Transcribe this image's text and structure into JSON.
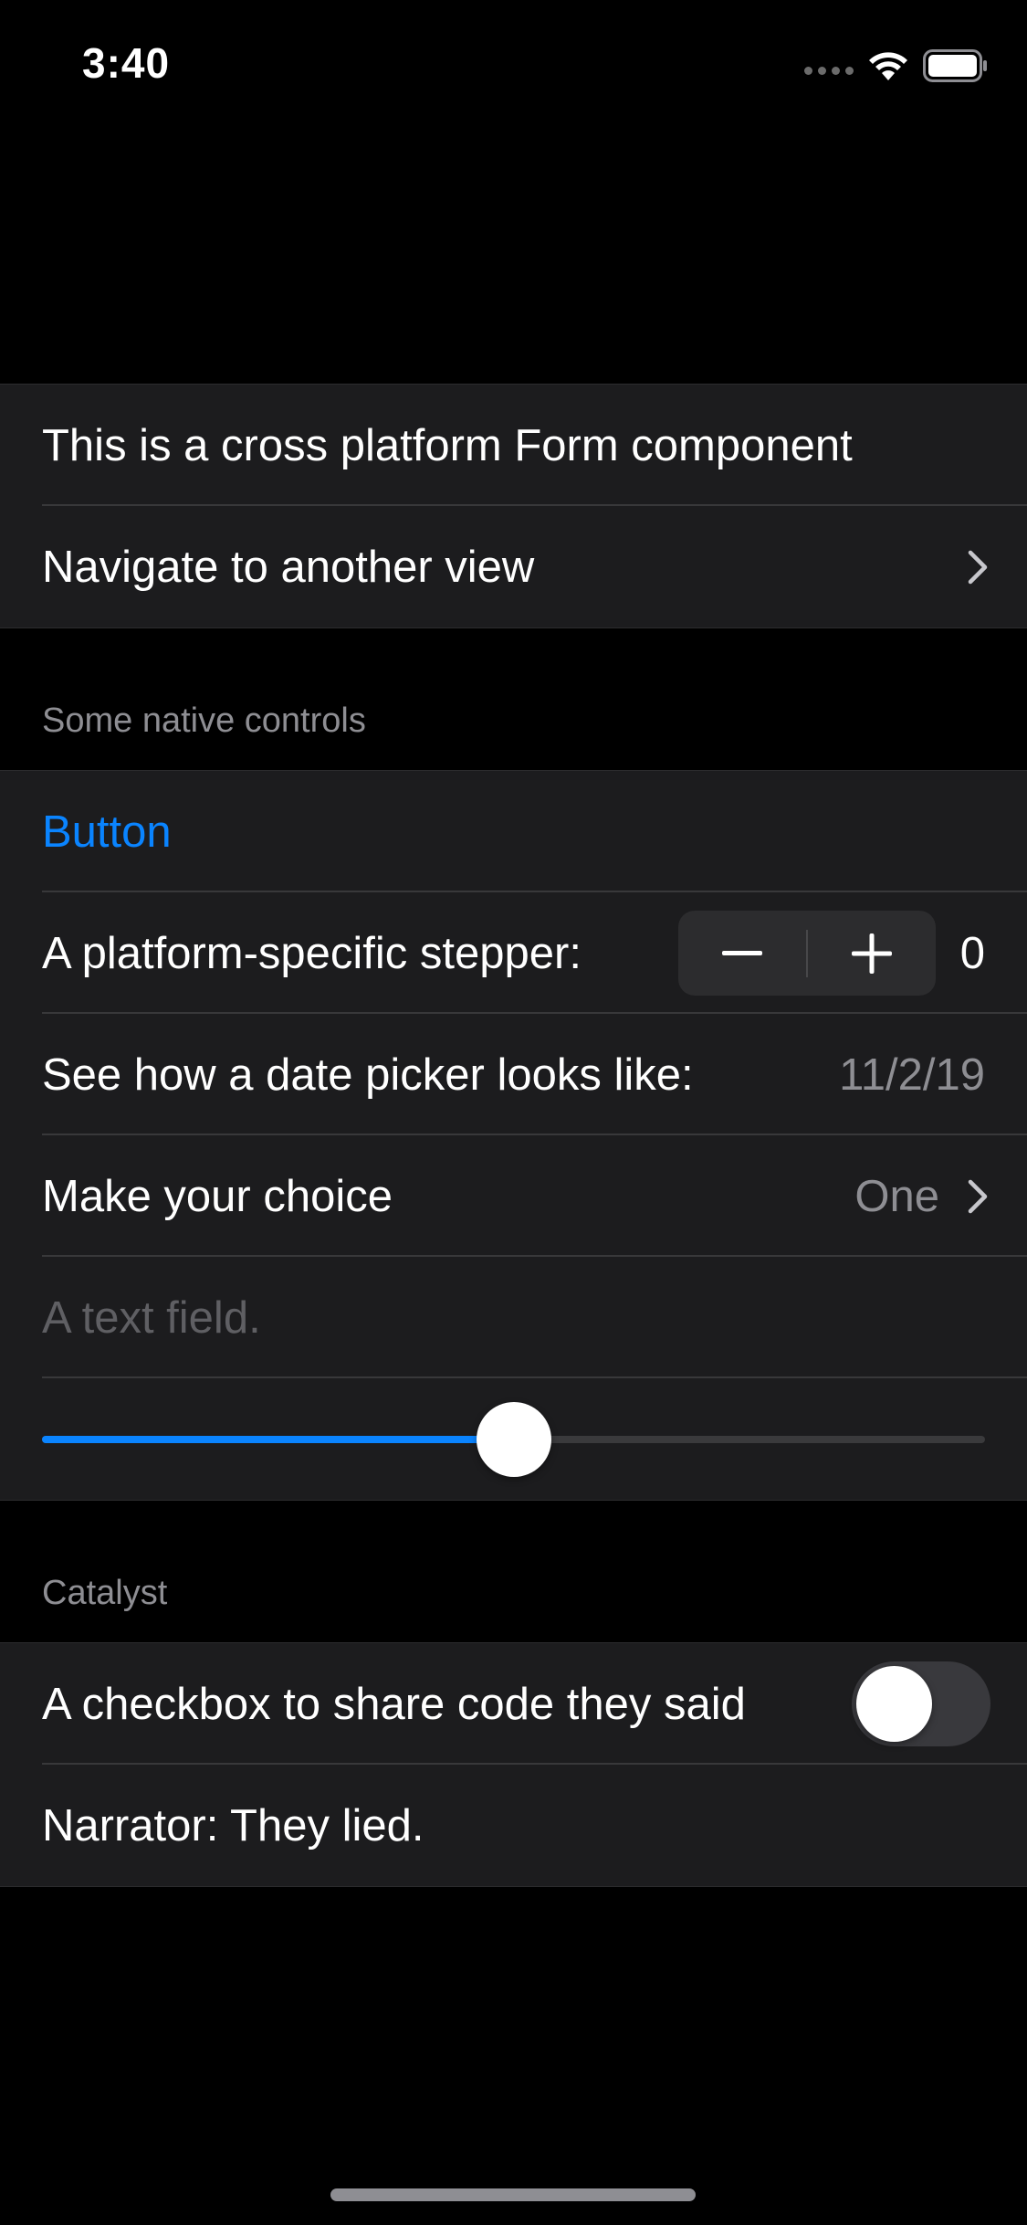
{
  "status_bar": {
    "time": "3:40",
    "signal_icon": "cellular-signal-icon",
    "wifi_icon": "wifi-icon",
    "battery_icon": "battery-icon"
  },
  "intro_group": {
    "description": "This is a cross platform Form component",
    "navigate_label": "Navigate to another view"
  },
  "native_controls": {
    "header": "Some native controls",
    "button_label": "Button",
    "stepper_label": "A platform-specific stepper:",
    "stepper_value": "0",
    "date_label": "See how a date picker looks like:",
    "date_value": "11/2/19",
    "choice_label": "Make your choice",
    "choice_value": "One",
    "text_field_placeholder": "A text field.",
    "slider_value_fraction": 0.5
  },
  "catalyst": {
    "header": "Catalyst",
    "checkbox_label": "A checkbox to share code they said",
    "checkbox_on": false,
    "narrator_text": "Narrator: They lied."
  },
  "colors": {
    "background": "#000000",
    "row_background": "#1c1c1e",
    "accent": "#0a84ff",
    "secondary_text": "#8e8e93"
  }
}
